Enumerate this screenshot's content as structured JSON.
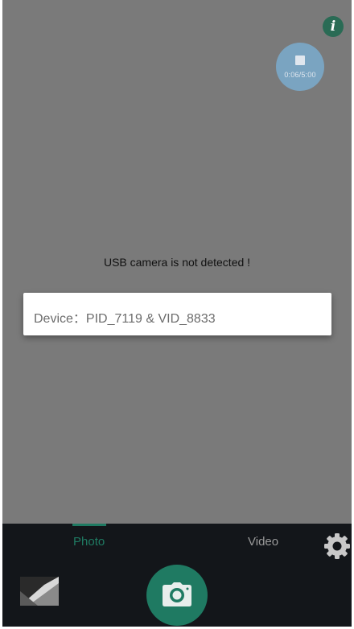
{
  "top": {
    "info_icon": "info-icon",
    "info_glyph": "i",
    "recording_time": "0:06/5:00",
    "stop_icon": "stop-icon"
  },
  "preview": {
    "notice": "USB camera is not detected !",
    "device_label": "Device：PID_7119 & VID_8833"
  },
  "bottom_bar": {
    "tabs": [
      {
        "label": "Photo",
        "active": true
      },
      {
        "label": "Video",
        "active": false
      }
    ],
    "settings_icon": "gear-icon",
    "shutter_icon": "camera-icon",
    "gallery_thumb": "gallery-thumbnail"
  },
  "colors": {
    "accent": "#1f7a62",
    "overlay": "#7b7b7b",
    "bar": "#13161a",
    "record_bubble": "#7aa4c1"
  }
}
